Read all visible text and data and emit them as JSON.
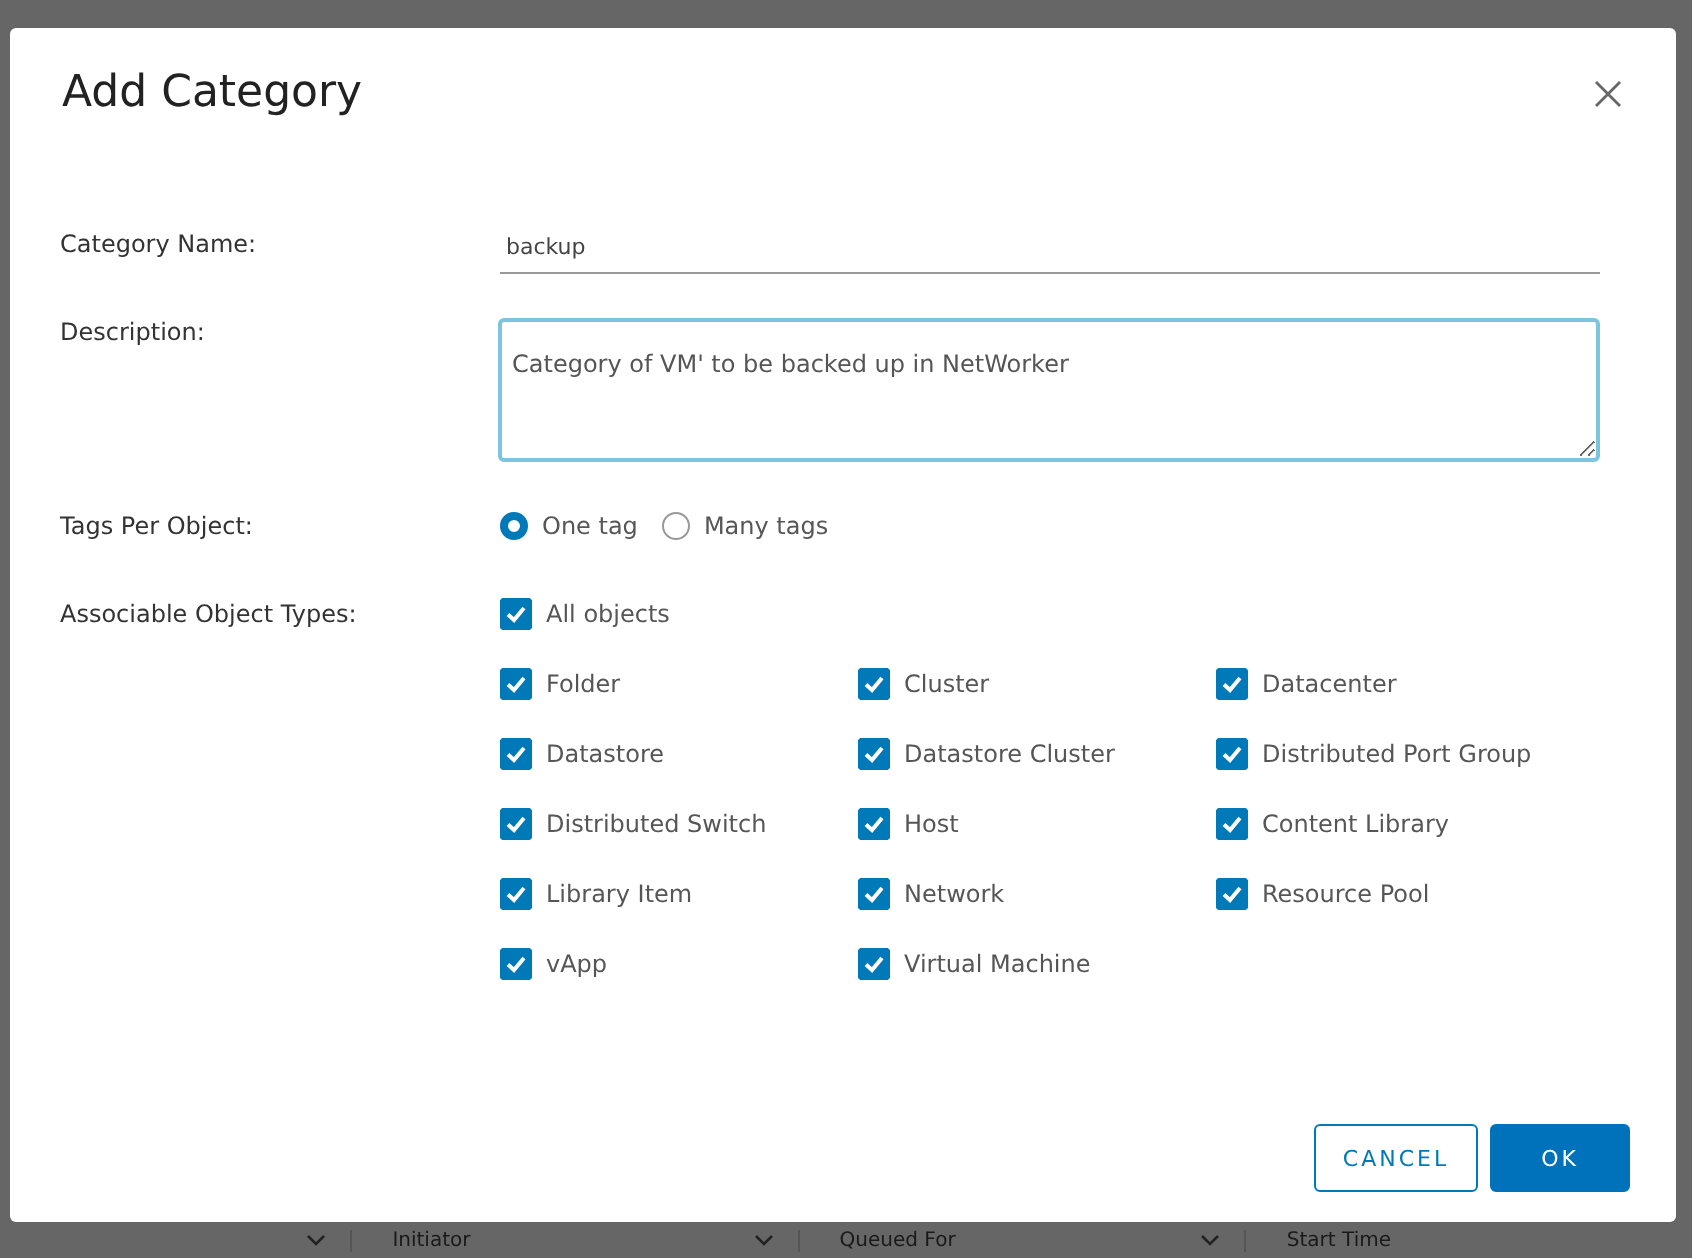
{
  "dialog": {
    "title": "Add Category",
    "category_name": {
      "label": "Category Name:",
      "value": "backup"
    },
    "description": {
      "label": "Description:",
      "value": "Category of VM' to be backed up in NetWorker"
    },
    "tags_per_object": {
      "label": "Tags Per Object:",
      "options": [
        {
          "label": "One tag",
          "selected": true
        },
        {
          "label": "Many tags",
          "selected": false
        }
      ]
    },
    "associable_object_types": {
      "label": "Associable Object Types:",
      "all_objects": {
        "label": "All objects",
        "checked": true
      },
      "types": [
        {
          "label": "Folder",
          "checked": true
        },
        {
          "label": "Cluster",
          "checked": true
        },
        {
          "label": "Datacenter",
          "checked": true
        },
        {
          "label": "Datastore",
          "checked": true
        },
        {
          "label": "Datastore Cluster",
          "checked": true
        },
        {
          "label": "Distributed Port Group",
          "checked": true
        },
        {
          "label": "Distributed Switch",
          "checked": true
        },
        {
          "label": "Host",
          "checked": true
        },
        {
          "label": "Content Library",
          "checked": true
        },
        {
          "label": "Library Item",
          "checked": true
        },
        {
          "label": "Network",
          "checked": true
        },
        {
          "label": "Resource Pool",
          "checked": true
        },
        {
          "label": "vApp",
          "checked": true
        },
        {
          "label": "Virtual Machine",
          "checked": true
        }
      ]
    },
    "buttons": [
      {
        "label": "CANCEL",
        "kind": "outline"
      },
      {
        "label": "OK",
        "kind": "primary"
      }
    ]
  },
  "background_table": {
    "columns": [
      "Initiator",
      "Queued For",
      "Start Time"
    ]
  }
}
